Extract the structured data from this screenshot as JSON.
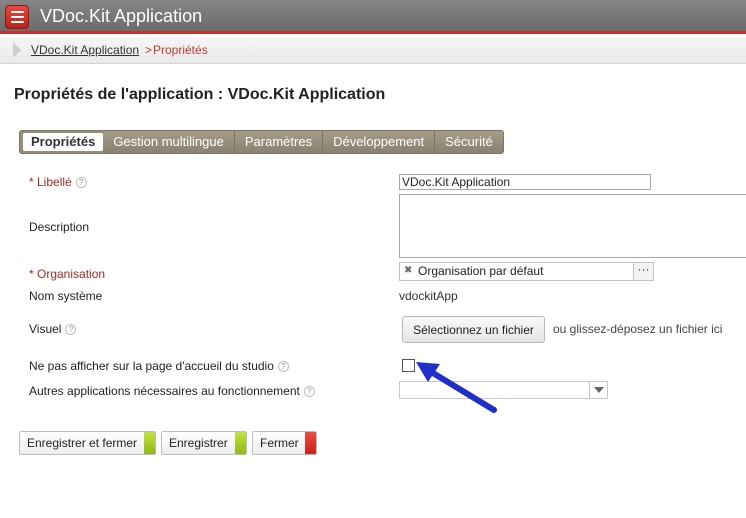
{
  "window": {
    "title": "VDoc.Kit Application",
    "icon": "app-list-icon",
    "accent": "#c9322b"
  },
  "breadcrumb": {
    "parent": "VDoc.Kit Application",
    "separator": ">",
    "current": "Propriétés"
  },
  "page_title": "Propriétés de l'application : VDoc.Kit Application",
  "tabs": [
    {
      "label": "Propriétés",
      "active": true
    },
    {
      "label": "Gestion multilingue"
    },
    {
      "label": "Paramètres"
    },
    {
      "label": "Développement"
    },
    {
      "label": "Sécurité"
    }
  ],
  "form": {
    "libelle": {
      "label": "* Libellé",
      "value": "VDoc.Kit Application"
    },
    "description": {
      "label": "Description",
      "value": ""
    },
    "organisation": {
      "label": "* Organisation",
      "value": "Organisation par défaut",
      "remove": "✖",
      "more": "···"
    },
    "nom_systeme": {
      "label": "Nom système",
      "value": "vdockitApp"
    },
    "visuel": {
      "label": "Visuel",
      "button": "Sélectionnez un fichier",
      "hint": "ou glissez-déposez un fichier ici"
    },
    "hide_home": {
      "label": "Ne pas afficher sur la page d'accueil du studio",
      "checked": false
    },
    "autres_apps": {
      "label": "Autres applications nécessaires au fonctionnement",
      "value": ""
    },
    "help_glyph": "?"
  },
  "buttons": {
    "save_close": "Enregistrer et fermer",
    "save": "Enregistrer",
    "close": "Fermer"
  }
}
